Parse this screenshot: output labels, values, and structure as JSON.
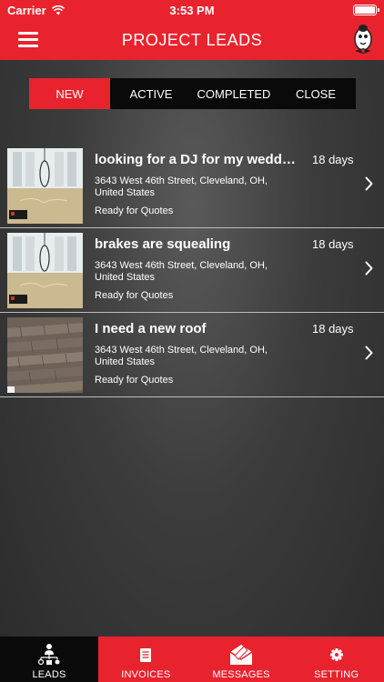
{
  "status_bar": {
    "carrier": "Carrier",
    "time": "3:53 PM"
  },
  "nav": {
    "title": "PROJECT LEADS",
    "menu_icon": "hamburger-icon",
    "mascot_icon": "mascot-logo"
  },
  "segments": [
    {
      "label": "NEW",
      "active": true
    },
    {
      "label": "ACTIVE",
      "active": false
    },
    {
      "label": "COMPLETED",
      "active": false
    },
    {
      "label": "CLOSE",
      "active": false
    }
  ],
  "leads": [
    {
      "title": "looking for a DJ for my wedding",
      "age": "18 days",
      "address": "3643 West 46th Street, Cleveland, OH, United States",
      "status": "Ready for Quotes",
      "thumb": "wedding-photo"
    },
    {
      "title": "brakes are squealing",
      "age": "18 days",
      "address": "3643 West 46th Street, Cleveland, OH, United States",
      "status": "Ready for Quotes",
      "thumb": "wedding-photo"
    },
    {
      "title": "I need a new roof",
      "age": "18 days",
      "address": "3643 West 46th Street, Cleveland, OH, United States",
      "status": "Ready for Quotes",
      "thumb": "roof-photo"
    }
  ],
  "tabs": [
    {
      "label": "LEADS",
      "icon": "leads-icon",
      "active": true
    },
    {
      "label": "INVOICES",
      "icon": "invoices-icon",
      "active": false
    },
    {
      "label": "MESSAGES",
      "icon": "messages-icon",
      "active": false
    },
    {
      "label": "SETTING",
      "icon": "gear-icon",
      "active": false
    }
  ],
  "colors": {
    "accent": "#e8232e",
    "dark": "#0a0a0a",
    "background": "#3c3c3c"
  }
}
